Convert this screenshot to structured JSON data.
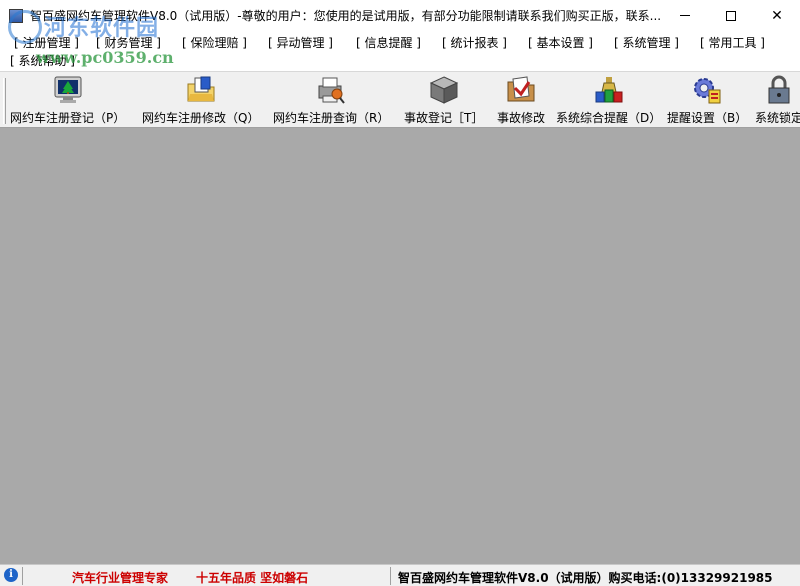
{
  "window": {
    "title": "智百盛网约车管理软件V8.0（试用版）-尊敬的用户：您使用的是试用版，有部分功能限制请联系我们购买正版，联系...",
    "minimize_glyph": "—",
    "maximize_glyph": "☐",
    "close_glyph": "✕"
  },
  "watermark": {
    "name": "河东软件园",
    "url": "www.pc0359.cn"
  },
  "menu": {
    "items": [
      {
        "label": "[ 注册管理 ]"
      },
      {
        "label": "[ 财务管理 ]"
      },
      {
        "label": "[ 保险理赔 ]"
      },
      {
        "label": "[ 异动管理 ]"
      },
      {
        "label": "[ 信息提醒 ]"
      },
      {
        "label": "[ 统计报表 ]"
      },
      {
        "label": "[ 基本设置 ]"
      },
      {
        "label": "[ 系统管理 ]"
      },
      {
        "label": "[ 常用工具 ]"
      },
      {
        "label": "[ 系统帮助 ]"
      }
    ]
  },
  "toolbar": {
    "buttons": [
      {
        "label": "网约车注册登记（P）",
        "icon": "monitor-tree-icon"
      },
      {
        "label": "网约车注册修改（Q）",
        "icon": "folder-edit-icon"
      },
      {
        "label": "网约车注册查询（R）",
        "icon": "search-printer-icon"
      },
      {
        "label": "事故登记［T］",
        "icon": "cube-icon"
      },
      {
        "label": "事故修改",
        "icon": "accident-edit-icon"
      },
      {
        "label": "系统综合提醒（D）",
        "icon": "alert-bottles-icon"
      },
      {
        "label": "提醒设置（B）",
        "icon": "gear-settings-icon"
      },
      {
        "label": "系统锁定",
        "icon": "lock-icon"
      }
    ]
  },
  "statusbar": {
    "icon": "info-icon",
    "slogan1": "汽车行业管理专家",
    "slogan2": "十五年品质 坚如磐石",
    "product_info": "智百盛网约车管理软件V8.0（试用版）购买电话:(0)13329921985"
  },
  "colors": {
    "workspace": "#a9a9a9",
    "slogan": "#cc0000",
    "toolbar": "#f0f0f0"
  }
}
